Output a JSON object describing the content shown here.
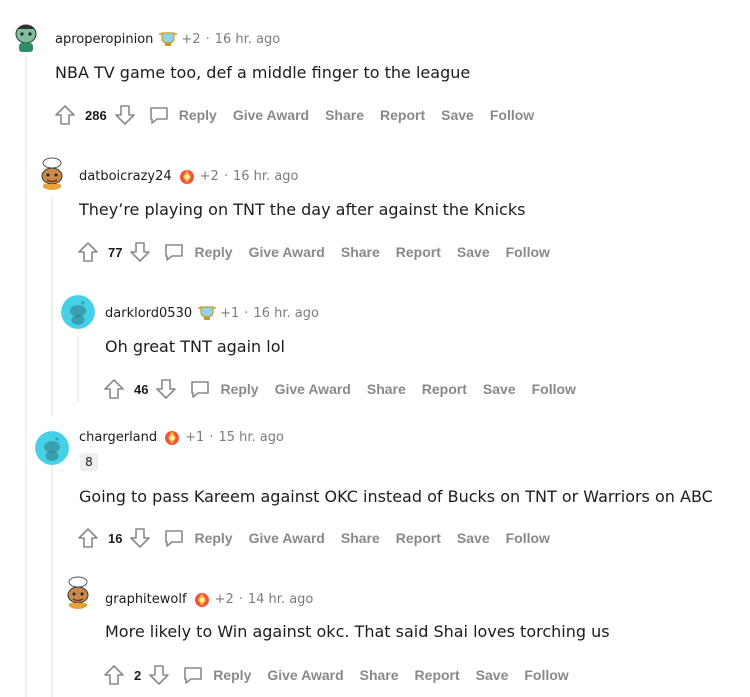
{
  "actions": {
    "reply": "Reply",
    "give_award": "Give Award",
    "share": "Share",
    "report": "Report",
    "save": "Save",
    "follow": "Follow"
  },
  "comments": [
    {
      "author": "aproperopinion",
      "karma": "+2",
      "dot": "·",
      "time": "16 hr. ago",
      "text": "NBA TV game too, def a middle finger to the league",
      "score": "286",
      "avatar": "snoo-avatar-green"
    },
    {
      "author": "datboicrazy24",
      "karma": "+2",
      "dot": "·",
      "time": "16 hr. ago",
      "text": "They’re playing on TNT the day after against the Knicks",
      "score": "77",
      "avatar": "snoo-avatar-chef"
    },
    {
      "author": "darklord0530",
      "karma": "+1",
      "dot": "·",
      "time": "16 hr. ago",
      "text": "Oh great TNT again lol",
      "score": "46",
      "avatar": "default-snoo-avatar"
    },
    {
      "author": "chargerland",
      "karma": "+1",
      "dot": "·",
      "time": "15 hr. ago",
      "badge": "8",
      "text": "Going to pass Kareem against OKC instead of Bucks on TNT or Warriors on ABC",
      "score": "16",
      "avatar": "default-snoo-avatar"
    },
    {
      "author": "graphitewolf",
      "karma": "+2",
      "dot": "·",
      "time": "14 hr. ago",
      "text": "More likely to Win against okc. That said Shai loves torching us",
      "score": "2",
      "avatar": "snoo-avatar-chef"
    }
  ],
  "colors": {
    "text": "#1c1c1c",
    "meta": "#7c7c7c",
    "action": "#878a8c",
    "thread_line": "#edeff1",
    "default_avatar_bg": "#46d1e7"
  }
}
